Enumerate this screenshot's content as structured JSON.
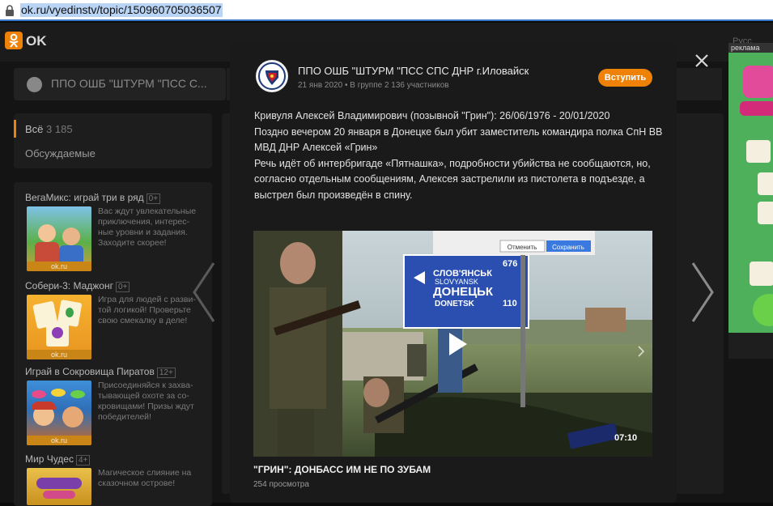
{
  "browser": {
    "url": "ok.ru/vyedinstv/topic/150960705036507"
  },
  "okbar": {
    "brand": "OK",
    "right_label": "Русс"
  },
  "background": {
    "group_title": "ППО ОШБ \"ШТУРМ \"ПСС С...",
    "tabs": [
      {
        "label": "Всё",
        "count": "3 185"
      },
      {
        "label": "Обсуждаемые"
      }
    ],
    "games": [
      {
        "title": "ВегаМикс: играй три в ряд",
        "age": "0+",
        "desc": "Вас ждут увлекательные приключения, интерес-ные уровни и задания. Заходите скорее!",
        "source": "ok.ru"
      },
      {
        "title": "Собери-3: Маджонг",
        "age": "0+",
        "desc": "Игра для людей с разви-той логикой! Проверьте свою смекалку в деле!",
        "source": "ok.ru"
      },
      {
        "title": "Играй в Сокровища Пиратов",
        "age": "12+",
        "desc": "Присоединяйся к захва-тывающей охоте за со-кровищами! Призы ждут победителей!",
        "source": "ok.ru"
      },
      {
        "title": "Мир Чудес",
        "age": "4+",
        "desc": "Магическое слияние на сказочном острове!",
        "source": ""
      }
    ]
  },
  "post": {
    "group_name": "ППО ОШБ \"ШТУРМ \"ПСС СПС ДНР г.Иловайск",
    "date": "21 янв 2020",
    "group_info": "В группе 2 136 участников",
    "join_label": "Вступить",
    "text_lines": [
      "Кривуля Алексей Владимирович (позывной \"Грин\"): 26/06/1976 - 20/01/2020",
      "Поздно вечером 20 января в Донецке был убит заместитель командира полка СпН ВВ МВД ДНР Алексей «Грин»",
      "Речь идёт об интербригаде «Пятнашка», подробности убийства не сообщаются, но, согласно отдельным сообщениям, Алексея застрелили из пистолета в подъезде, а выстрел был произведён в спину."
    ],
    "video": {
      "duration": "07:10",
      "sign_lines": [
        "СЛОВ'ЯНСЬК",
        "SLOVYANSK",
        "ДОНЕЦЬК",
        "DONETSK"
      ],
      "sign_numbers": [
        "676",
        "110"
      ],
      "dialog_cancel": "Отменить",
      "dialog_save": "Сохранить",
      "title": "\"ГРИН\": ДОНБАСС ИМ НЕ ПО ЗУБАМ",
      "views": "254 просмотра"
    }
  },
  "ad": {
    "label": "реклама"
  },
  "colors": {
    "accent": "#ee8208",
    "modal_bg": "#1a1a1a",
    "page_bg": "#141414"
  }
}
